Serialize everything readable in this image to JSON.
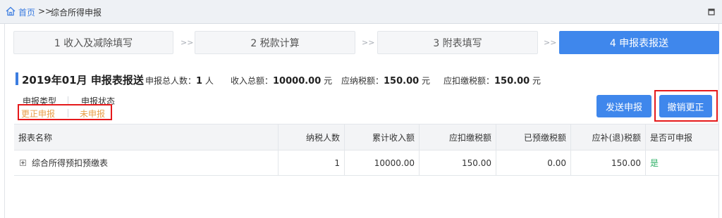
{
  "breadcrumb": {
    "home": "首页",
    "separator": ">>",
    "current": "综合所得申报"
  },
  "steps": [
    {
      "label": "1 收入及减除填写"
    },
    {
      "label": "2 税款计算"
    },
    {
      "label": "3 附表填写"
    },
    {
      "label": "4 申报表报送"
    }
  ],
  "step_arrow": ">>",
  "header": {
    "title": "2019年01月  申报表报送",
    "total_people_label": "申报总人数：",
    "total_people_value": "1",
    "total_people_unit": "人",
    "income_label": "收入总额：",
    "income_value": "10000.00",
    "income_unit": "元",
    "tax_payable_label": "应纳税额：",
    "tax_payable_value": "150.00",
    "tax_payable_unit": "元",
    "withheld_label": "应扣缴税额：",
    "withheld_value": "150.00",
    "withheld_unit": "元"
  },
  "status": {
    "type_label": "申报类型",
    "status_label": "申报状态",
    "type_value": "更正申报",
    "status_value": "未申报"
  },
  "buttons": {
    "send": "发送申报",
    "cancel_correction": "撤销更正"
  },
  "table": {
    "columns": [
      "报表名称",
      "纳税人数",
      "累计收入额",
      "应扣缴税额",
      "已预缴税额",
      "应补(退)税额",
      "是否可申报"
    ],
    "rows": [
      {
        "name": "综合所得预扣预缴表",
        "people": "1",
        "income": "10000.00",
        "withheld": "150.00",
        "prepaid": "0.00",
        "refund": "150.00",
        "can_declare": "是"
      }
    ]
  },
  "colors": {
    "accent": "#3f87ec",
    "highlight_box": "#e5191b",
    "status_text": "#e8a04b",
    "yes_text": "#2fb067"
  }
}
